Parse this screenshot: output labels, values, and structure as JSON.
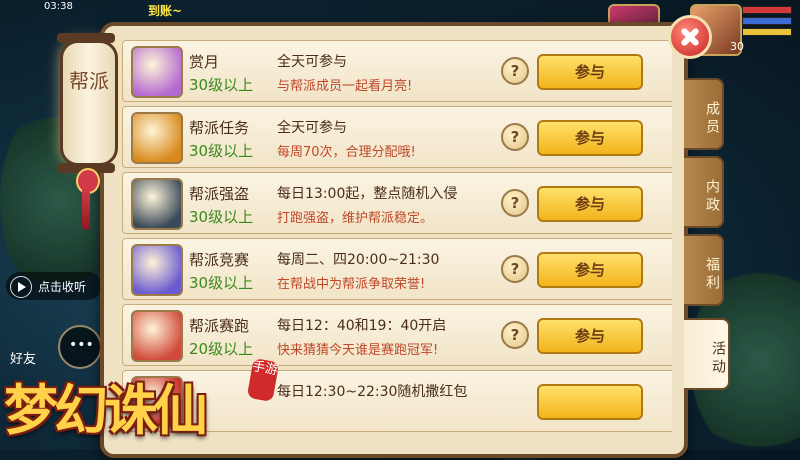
{
  "status_bar": {
    "time": "03:38"
  },
  "top_message": "到账~",
  "lantern_label": "帮派",
  "hud": {
    "voice_label": "点击收听",
    "friends_label": "好友",
    "player_level": "30"
  },
  "game_logo": {
    "title": "梦幻诛仙",
    "seal": "手游"
  },
  "tabs": [
    {
      "label": "成员",
      "active": false
    },
    {
      "label": "内政",
      "active": false
    },
    {
      "label": "福利",
      "active": false
    },
    {
      "label": "活动",
      "active": true
    }
  ],
  "activities": [
    {
      "name": "赏月",
      "level": "30级以上",
      "schedule": "全天可参与",
      "description": "与帮派成员一起看月亮!",
      "help": "?",
      "button": "参与",
      "icon": "moon-cake-icon",
      "icon_color": "#b46ad0"
    },
    {
      "name": "帮派任务",
      "level": "30级以上",
      "schedule": "全天可参与",
      "description": "每周70次，合理分配哦!",
      "help": "?",
      "button": "参与",
      "icon": "task-medal-icon",
      "icon_color": "#d88a1c"
    },
    {
      "name": "帮派强盗",
      "level": "30级以上",
      "schedule": "每日13:00起，整点随机入侵",
      "description": "打跑强盗，维护帮派稳定。",
      "help": "?",
      "button": "参与",
      "icon": "bandit-flag-icon",
      "icon_color": "#3a4a5a"
    },
    {
      "name": "帮派竞赛",
      "level": "30级以上",
      "schedule": "每周二、四20:00~21:30",
      "description": "在帮战中为帮派争取荣誉!",
      "help": "?",
      "button": "参与",
      "icon": "arena-icon",
      "icon_color": "#6a5ad0"
    },
    {
      "name": "帮派赛跑",
      "level": "20级以上",
      "schedule": "每日12：40和19：40开启",
      "description": "快来猜猜今天谁是赛跑冠军!",
      "help": "?",
      "button": "参与",
      "icon": "race-pig-icon",
      "icon_color": "#d04a3a"
    },
    {
      "name": "",
      "level": "",
      "schedule": "每日12:30~22:30随机撒红包",
      "description": "",
      "help": "",
      "button": "",
      "icon": "red-envelope-icon",
      "icon_color": "#c82222"
    }
  ],
  "colors": {
    "panel_bg": "#efe2c4",
    "border": "#6b4a2a",
    "join_button": "#f2b41c",
    "level_green": "#3b8a1c",
    "desc_red": "#c0482a"
  }
}
